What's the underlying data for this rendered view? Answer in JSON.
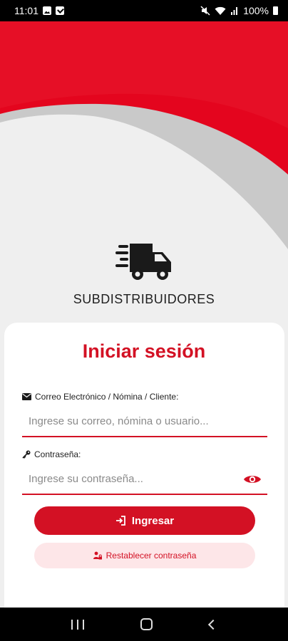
{
  "status_bar": {
    "time": "11:01",
    "battery": "100%",
    "icons": [
      "image-icon",
      "check-icon",
      "mute-icon",
      "wifi-icon",
      "signal-icon",
      "battery-icon"
    ]
  },
  "brand": {
    "logo_icon": "fast-truck-icon",
    "name": "SUBDISTRIBUIDORES"
  },
  "login": {
    "title": "Iniciar sesión",
    "user_label": "Correo Electrónico / Nómina / Cliente:",
    "user_icon": "envelope-icon",
    "user_placeholder": "Ingrese su correo, nómina o usuario...",
    "user_value": "",
    "password_label": "Contraseña:",
    "password_icon": "key-icon",
    "password_placeholder": "Ingrese su contraseña...",
    "password_value": "",
    "toggle_icon": "eye-icon",
    "submit_label": "Ingresar",
    "submit_icon": "sign-in-icon",
    "reset_label": "Restablecer contraseña",
    "reset_icon": "user-lock-icon"
  },
  "nav_bar": {
    "icons": [
      "recents-icon",
      "home-icon",
      "back-icon"
    ]
  },
  "colors": {
    "accent": "#d31124",
    "accent_soft": "#fde6e8",
    "background": "#efefef"
  }
}
